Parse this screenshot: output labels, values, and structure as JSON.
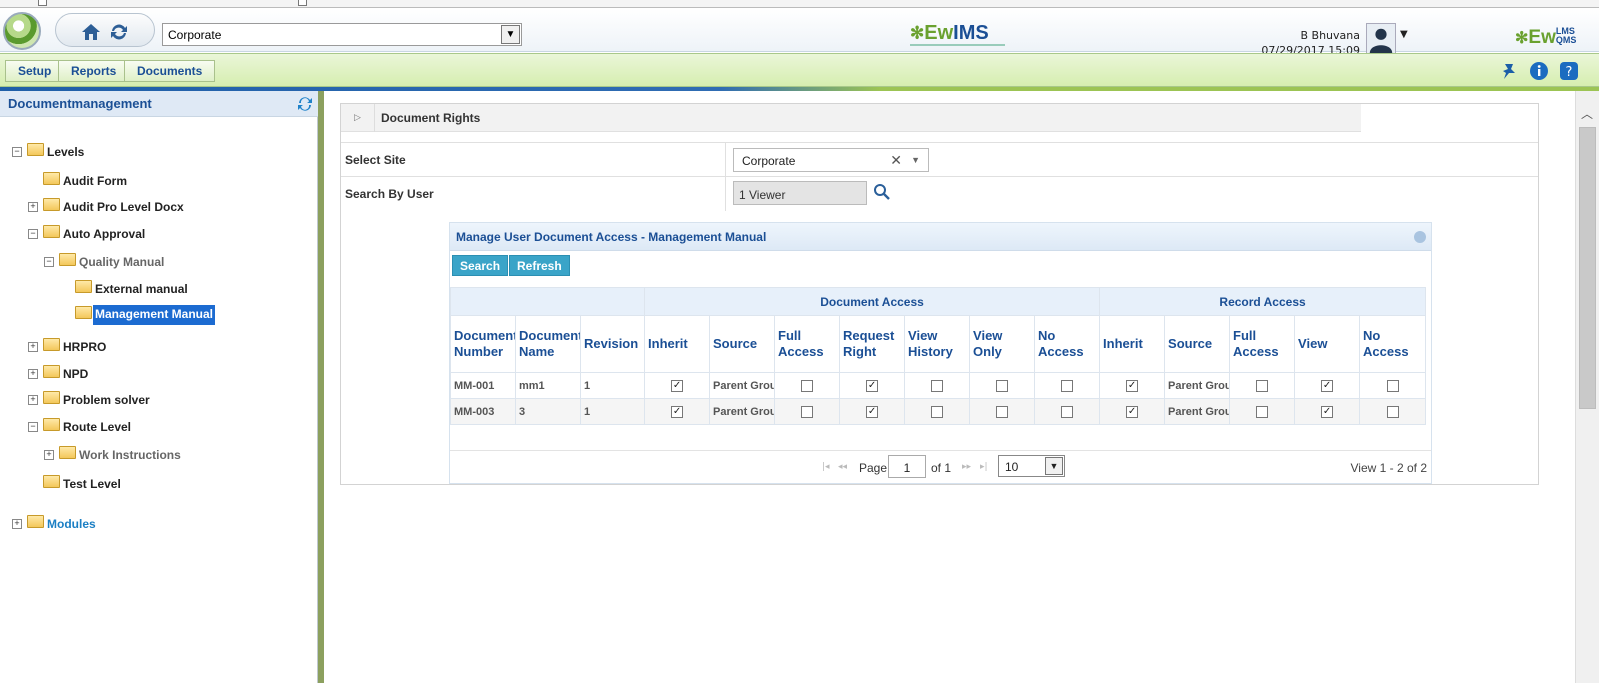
{
  "header": {
    "site_value": "Corporate",
    "brand_center": {
      "ew": "Ew",
      "ims": "IMS"
    },
    "brand_right": {
      "ew": "Ew",
      "lms": "LMS",
      "qms": "QMS"
    },
    "user_name": "B Bhuvana",
    "user_datetime": "07/29/2017 15:09"
  },
  "menu": {
    "setup": "Setup",
    "reports": "Reports",
    "documents": "Documents"
  },
  "sidebar": {
    "title": "Documentmanagement",
    "tree": [
      {
        "label": "Levels",
        "toggle": "−"
      },
      {
        "label": "Audit Form",
        "toggle": ""
      },
      {
        "label": "Audit Pro Level Docx",
        "toggle": "+"
      },
      {
        "label": "Auto Approval",
        "toggle": "−"
      },
      {
        "label": "Quality Manual",
        "toggle": "−"
      },
      {
        "label": "External manual",
        "toggle": ""
      },
      {
        "label": "Management Manual",
        "toggle": ""
      },
      {
        "label": "HRPRO",
        "toggle": "+"
      },
      {
        "label": "NPD",
        "toggle": "+"
      },
      {
        "label": "Problem solver",
        "toggle": "+"
      },
      {
        "label": "Route Level",
        "toggle": "−"
      },
      {
        "label": "Work Instructions",
        "toggle": "+"
      },
      {
        "label": "Test Level",
        "toggle": ""
      },
      {
        "label": "Modules",
        "toggle": "+"
      }
    ]
  },
  "panel": {
    "title": "Document Rights",
    "select_site_label": "Select Site",
    "select_site_value": "Corporate",
    "search_user_label": "Search By User",
    "search_user_value": "1 Viewer"
  },
  "grid": {
    "title": "Manage User Document Access - Management Manual",
    "search_button": "Search",
    "refresh_button": "Refresh",
    "group_document_access": "Document Access",
    "group_record_access": "Record Access",
    "columns": [
      "Document Number",
      "Document Name",
      "Revision",
      "Inherit",
      "Source",
      "Full Access",
      "Request Right",
      "View History",
      "View Only",
      "No Access",
      "Inherit",
      "Source",
      "Full Access",
      "View",
      "No Access"
    ],
    "rows": [
      {
        "number": "MM-001",
        "name": "mm1",
        "revision": "1",
        "source": "Parent Group",
        "rec_source": "Parent Group",
        "checks": [
          true,
          false,
          true,
          false,
          false,
          false,
          true,
          false,
          true,
          false
        ]
      },
      {
        "number": "MM-003",
        "name": "3",
        "revision": "1",
        "source": "Parent Group",
        "rec_source": "Parent Group",
        "checks": [
          true,
          false,
          true,
          false,
          false,
          false,
          true,
          false,
          true,
          false
        ]
      }
    ],
    "pager": {
      "page_label": "Page",
      "page_value": "1",
      "of_label": "of 1",
      "rows_value": "10",
      "view_text": "View 1 - 2 of 2"
    }
  }
}
